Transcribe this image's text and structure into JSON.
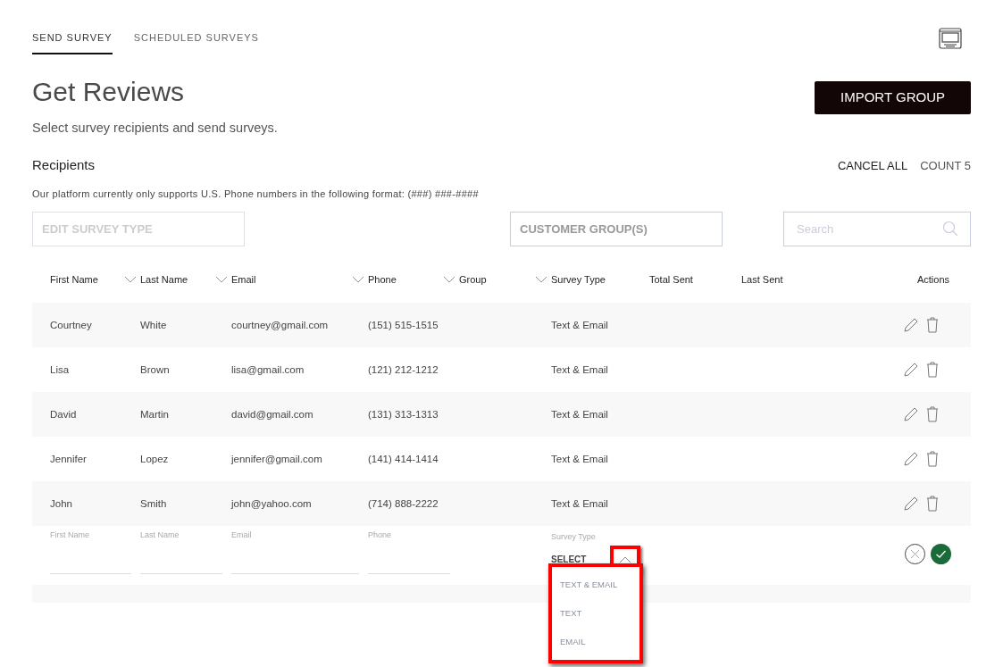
{
  "tabs": [
    {
      "label": "SEND SURVEY",
      "selected": true
    },
    {
      "label": "SCHEDULED SURVEYS",
      "selected": false
    }
  ],
  "title": "Get Reviews",
  "subtitle": "Select survey recipients and send surveys.",
  "import_button": "IMPORT GROUP",
  "recipients": {
    "heading": "Recipients",
    "cancel_all": "CANCEL ALL",
    "count": "COUNT 5",
    "note": "Our platform currently only supports U.S. Phone numbers in the following format: (###) ###-####"
  },
  "filters": {
    "survey_type": {
      "placeholder": "EDIT SURVEY TYPE"
    },
    "customer_groups": {
      "placeholder": "CUSTOMER GROUP(S)"
    },
    "search": {
      "placeholder": "Search"
    }
  },
  "table": {
    "columns": [
      {
        "label": "First Name",
        "sortable": true
      },
      {
        "label": "Last Name",
        "sortable": true
      },
      {
        "label": "Email",
        "sortable": true
      },
      {
        "label": "Phone",
        "sortable": true
      },
      {
        "label": "Group",
        "sortable": true
      },
      {
        "label": "Survey Type",
        "sortable": false
      },
      {
        "label": "Total Sent",
        "sortable": false
      },
      {
        "label": "Last Sent",
        "sortable": false
      },
      {
        "label": "Actions",
        "sortable": false
      }
    ],
    "rows": [
      [
        "Courtney",
        "White",
        "courtney@gmail.com",
        "(151) 515-1515",
        "",
        "Text & Email"
      ],
      [
        "Lisa",
        "Brown",
        "lisa@gmail.com",
        "(121) 212-1212",
        "",
        "Text & Email"
      ],
      [
        "David",
        "Martin",
        "david@gmail.com",
        "(131) 313-1313",
        "",
        "Text & Email"
      ],
      [
        "Jennifer",
        "Lopez",
        "jennifer@gmail.com",
        "(141) 414-1414",
        "",
        "Text & Email"
      ],
      [
        "John",
        "Smith",
        "john@yahoo.com",
        "(714) 888-2222",
        "",
        "Text & Email"
      ]
    ],
    "new_row": {
      "fields": [
        {
          "label": "First Name"
        },
        {
          "label": "Last Name"
        },
        {
          "label": "Email"
        },
        {
          "label": "Phone"
        }
      ],
      "survey_type": {
        "label": "Survey Type",
        "value": "SELECT",
        "expanded": true,
        "options": [
          "TEXT & EMAIL",
          "TEXT",
          "EMAIL"
        ]
      }
    }
  }
}
